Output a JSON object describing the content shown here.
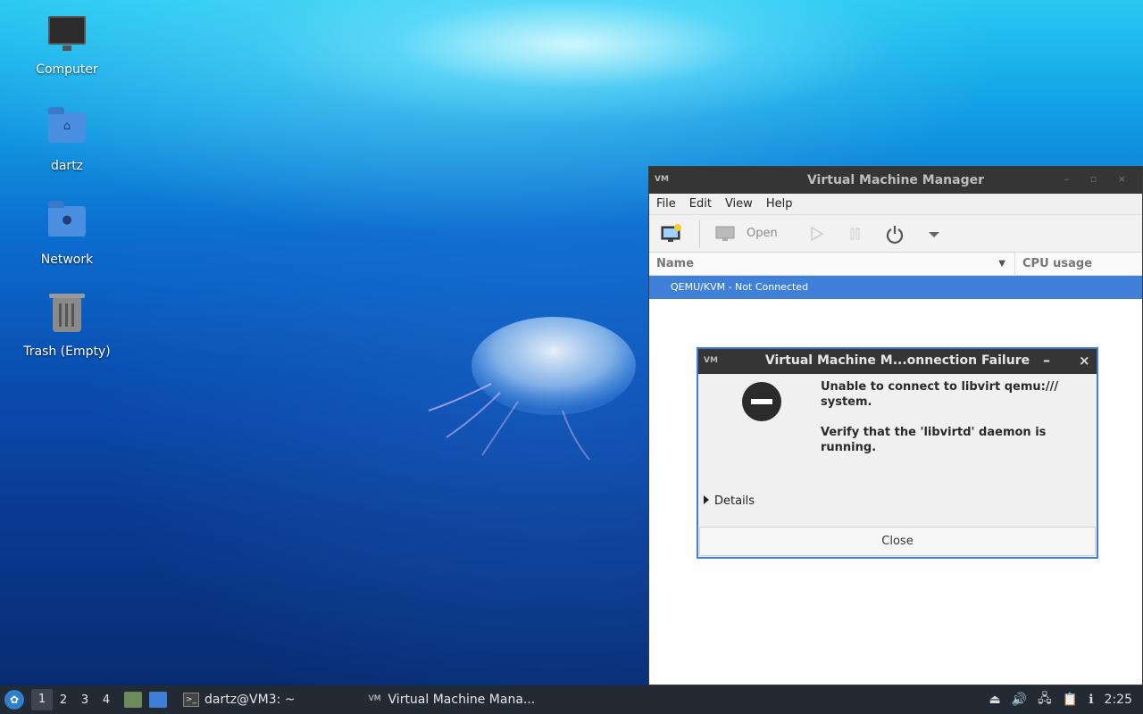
{
  "desktop": {
    "icons": [
      {
        "label": "Computer",
        "icon": "computer-icon"
      },
      {
        "label": "dartz",
        "icon": "home-folder-icon"
      },
      {
        "label": "Network",
        "icon": "network-folder-icon"
      },
      {
        "label": "Trash (Empty)",
        "icon": "trash-icon"
      }
    ]
  },
  "vmm": {
    "title": "Virtual Machine Manager",
    "logo": "VM",
    "menu": [
      "File",
      "Edit",
      "View",
      "Help"
    ],
    "toolbar": {
      "open_label": "Open"
    },
    "columns": {
      "name": "Name",
      "cpu": "CPU usage"
    },
    "rows": [
      {
        "label": "QEMU/KVM - Not Connected",
        "selected": true
      }
    ]
  },
  "dialog": {
    "title": "Virtual Machine M...onnection Failure",
    "logo": "VM",
    "min": "–",
    "close": "×",
    "message1": "Unable to connect to libvirt qemu:/// system.",
    "message2": "Verify that the 'libvirtd' daemon is running.",
    "details_label": "Details",
    "close_label": "Close"
  },
  "taskbar": {
    "workspaces": [
      "1",
      "2",
      "3",
      "4"
    ],
    "active_workspace": "1",
    "tasks": [
      {
        "label": "dartz@VM3: ~",
        "icon": "terminal-icon"
      },
      {
        "label": "Virtual Machine Mana...",
        "icon": "vmm-icon"
      }
    ],
    "clock": "2:25"
  },
  "colors": {
    "accent": "#3f80d8",
    "titlebar": "#353535",
    "taskbar": "#222a33"
  }
}
